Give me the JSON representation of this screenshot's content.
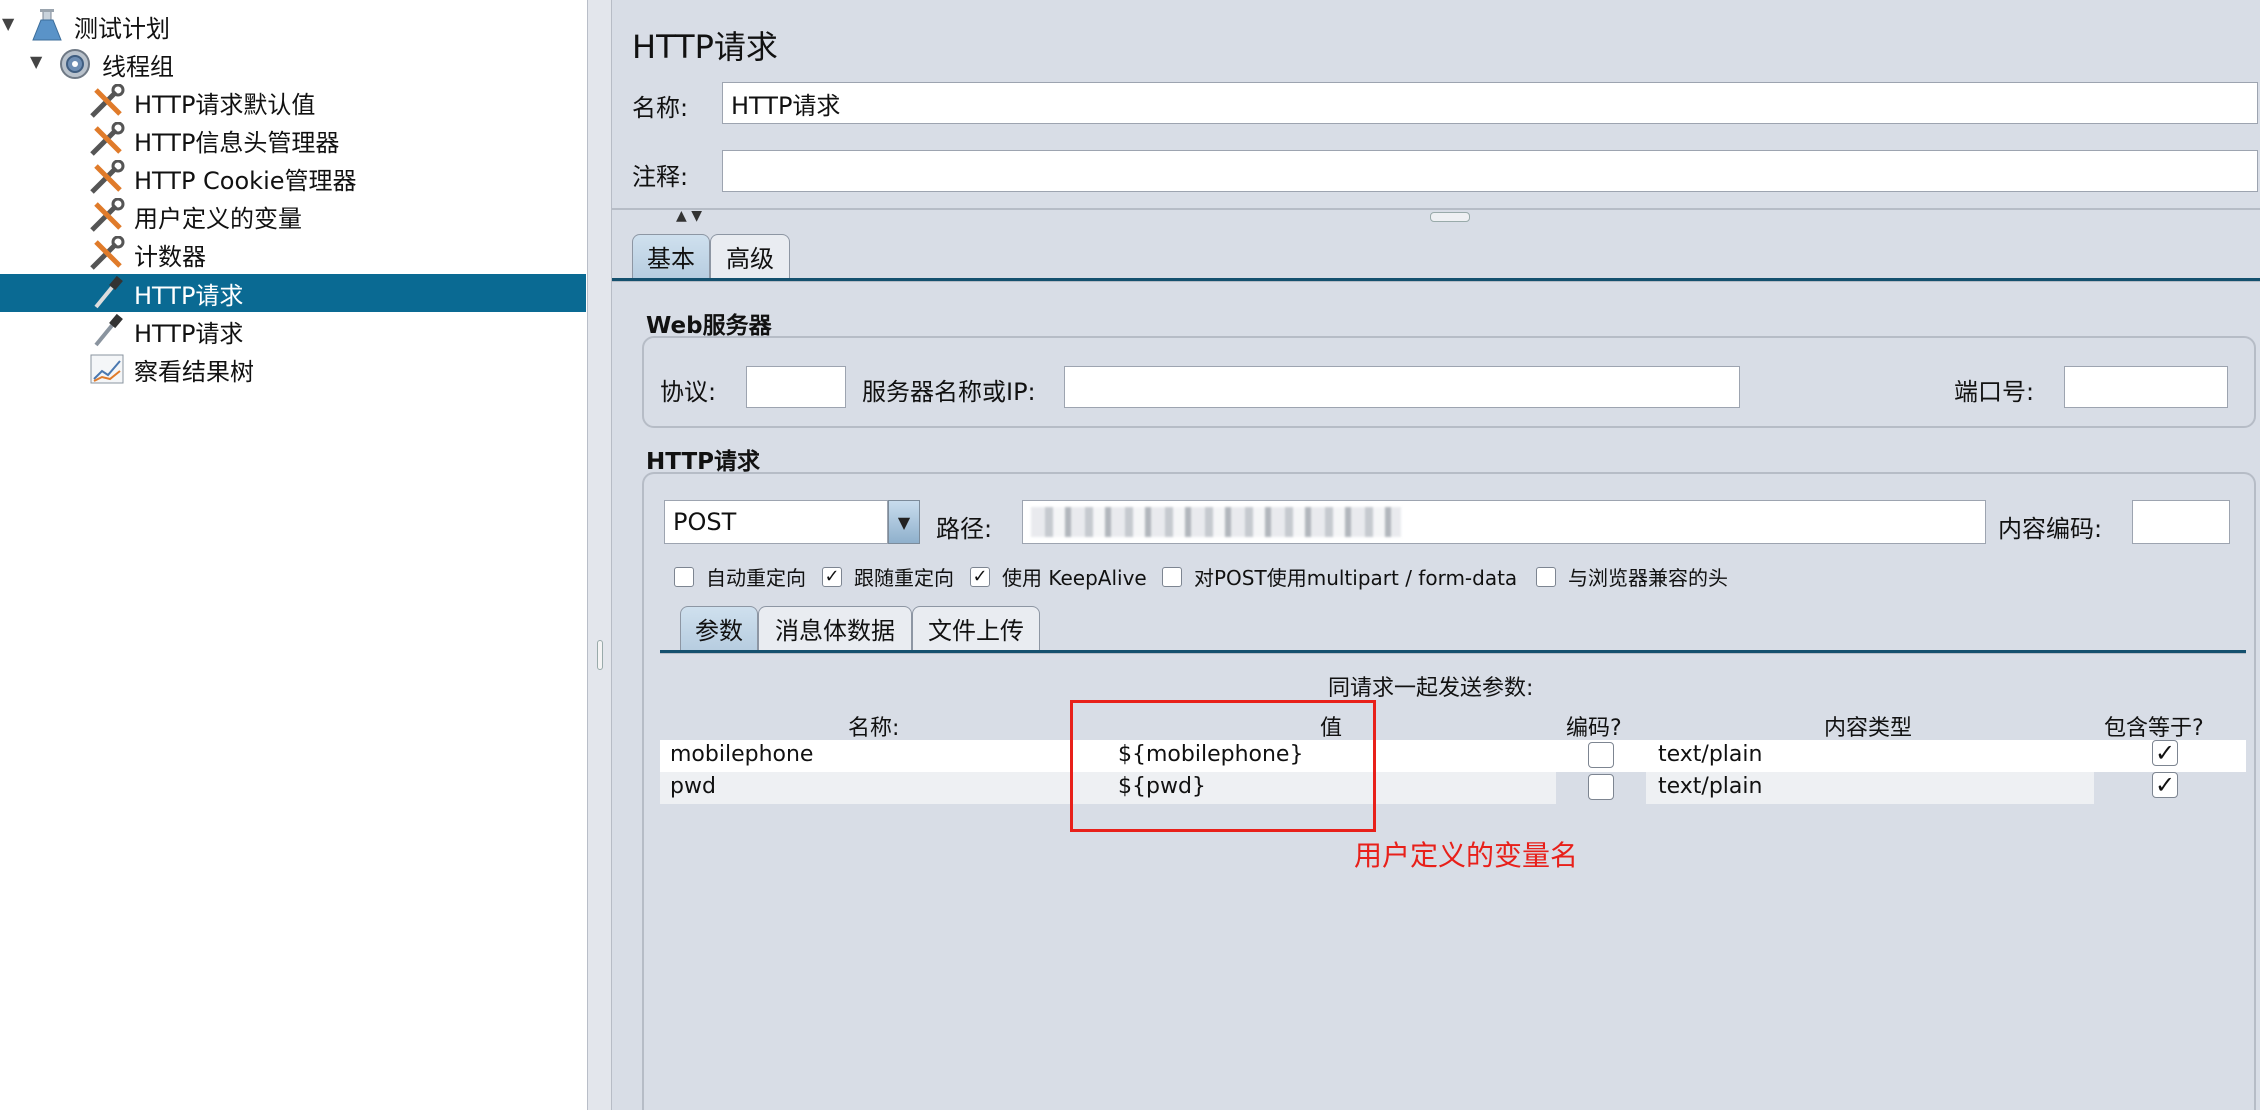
{
  "tree": {
    "items": [
      {
        "label": "测试计划",
        "icon": "test-plan-flask-icon"
      },
      {
        "label": "线程组",
        "icon": "thread-group-gear-icon"
      },
      {
        "label": "HTTP请求默认值",
        "icon": "config-wrench-icon"
      },
      {
        "label": "HTTP信息头管理器",
        "icon": "config-wrench-icon"
      },
      {
        "label": "HTTP Cookie管理器",
        "icon": "config-wrench-icon"
      },
      {
        "label": "用户定义的变量",
        "icon": "config-wrench-icon"
      },
      {
        "label": "计数器",
        "icon": "config-wrench-icon"
      },
      {
        "label": "HTTP请求",
        "icon": "sampler-pipette-icon",
        "selected": true
      },
      {
        "label": "HTTP请求",
        "icon": "sampler-pipette-icon"
      },
      {
        "label": "察看结果树",
        "icon": "listener-graph-icon"
      }
    ]
  },
  "panel": {
    "title": "HTTP请求",
    "name_label": "名称:",
    "name_value": "HTTP请求",
    "comment_label": "注释:",
    "comment_value": "",
    "tabs": [
      "基本",
      "高级"
    ]
  },
  "web_server": {
    "title": "Web服务器",
    "protocol_label": "协议:",
    "protocol_value": "",
    "server_label": "服务器名称或IP:",
    "server_value": "",
    "port_label": "端口号:",
    "port_value": ""
  },
  "http_request": {
    "title": "HTTP请求",
    "method": "POST",
    "path_label": "路径:",
    "encoding_label": "内容编码:",
    "encoding_value": "",
    "options": [
      {
        "label": "自动重定向",
        "checked": false
      },
      {
        "label": "跟随重定向",
        "checked": true
      },
      {
        "label": "使用 KeepAlive",
        "checked": true
      },
      {
        "label": "对POST使用multipart / form-data",
        "checked": false
      },
      {
        "label": "与浏览器兼容的头",
        "checked": false
      }
    ],
    "sub_tabs": [
      "参数",
      "消息体数据",
      "文件上传"
    ]
  },
  "params": {
    "caption": "同请求一起发送参数:",
    "columns": [
      "名称:",
      "值",
      "编码?",
      "内容类型",
      "包含等于?"
    ],
    "rows": [
      {
        "name": "mobilephone",
        "value": "${mobilephone}",
        "encode": false,
        "content_type": "text/plain",
        "include_equals": true
      },
      {
        "name": "pwd",
        "value": "${pwd}",
        "encode": false,
        "content_type": "text/plain",
        "include_equals": true
      }
    ]
  },
  "annotation": {
    "text": "用户定义的变量名",
    "color": "#e8201a"
  },
  "colors": {
    "selection": "#0a6a93",
    "panel_bg": "#d8dde6"
  }
}
